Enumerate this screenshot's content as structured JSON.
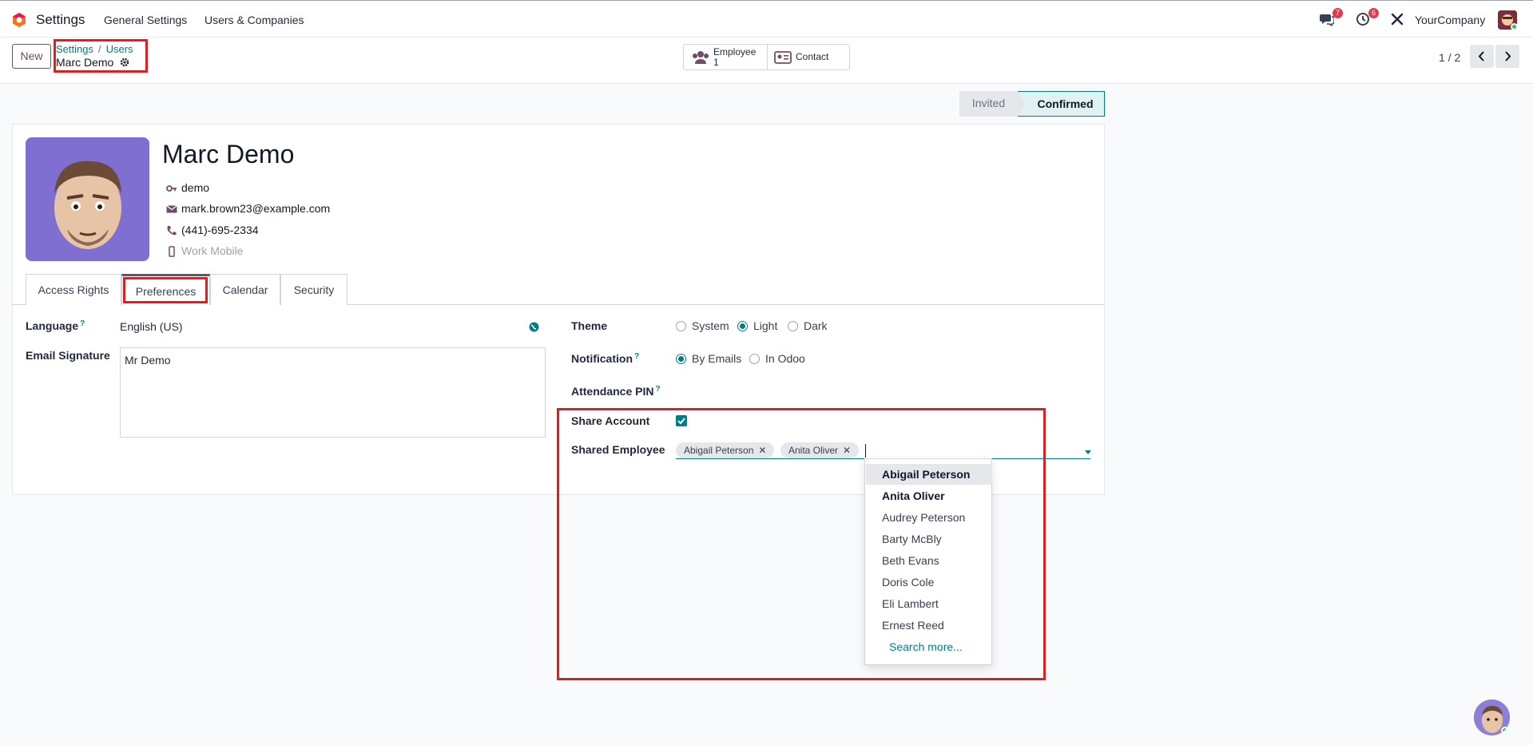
{
  "navbar": {
    "app_name": "Settings",
    "menus": [
      "General Settings",
      "Users & Companies"
    ],
    "messages_count": "7",
    "activities_count": "6",
    "company": "YourCompany"
  },
  "control": {
    "new_label": "New",
    "breadcrumb_root": "Settings",
    "breadcrumb_parent": "Users",
    "breadcrumb_current": "Marc Demo",
    "smart_employee_label": "Employee",
    "smart_employee_count": "1",
    "smart_contact_label": "Contact",
    "pager": "1 / 2"
  },
  "status": {
    "invited": "Invited",
    "confirmed": "Confirmed"
  },
  "user": {
    "name": "Marc Demo",
    "login": "demo",
    "email": "mark.brown23@example.com",
    "phone": "(441)-695-2334",
    "mobile_placeholder": "Work Mobile"
  },
  "tabs": [
    "Access Rights",
    "Preferences",
    "Calendar",
    "Security"
  ],
  "prefs": {
    "language_label": "Language",
    "language_value": "English (US)",
    "signature_label": "Email Signature",
    "signature_value": "Mr Demo",
    "theme_label": "Theme",
    "theme_options": [
      "System",
      "Light",
      "Dark"
    ],
    "theme_selected": "Light",
    "notification_label": "Notification",
    "notification_options": [
      "By Emails",
      "In Odoo"
    ],
    "notification_selected": "By Emails",
    "pin_label": "Attendance PIN",
    "share_label": "Share Account",
    "share_checked": true,
    "shared_employee_label": "Shared Employee",
    "shared_tags": [
      "Abigail Peterson",
      "Anita Oliver"
    ],
    "help_mark": "?"
  },
  "dropdown": {
    "items": [
      "Abigail Peterson",
      "Anita Oliver",
      "Audrey Peterson",
      "Barty McBly",
      "Beth Evans",
      "Doris Cole",
      "Eli Lambert",
      "Ernest Reed"
    ],
    "search_more": "Search more..."
  },
  "colors": {
    "brand": "#714b67",
    "accent": "#017e84",
    "highlight": "#e11d1d"
  }
}
